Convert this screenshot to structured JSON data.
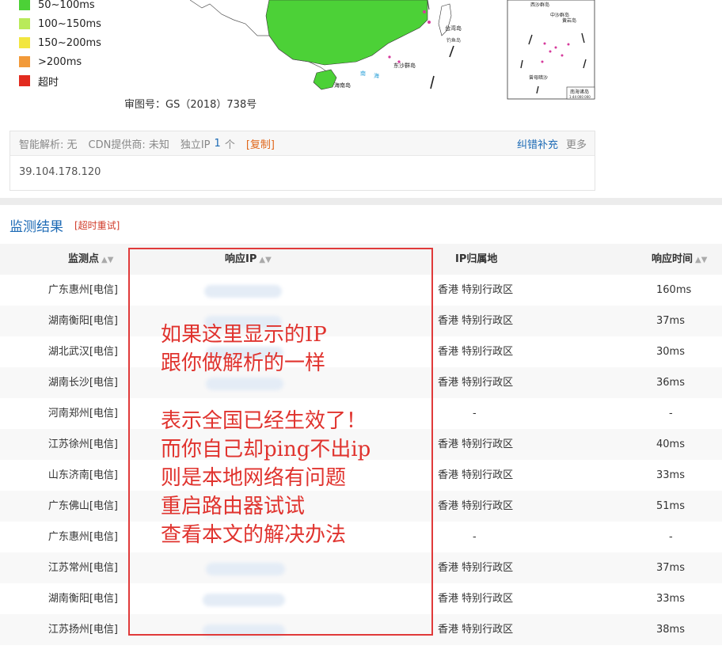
{
  "legend": [
    {
      "label": "50~100ms",
      "color": "#4cd137"
    },
    {
      "label": "100~150ms",
      "color": "#b9ea5a"
    },
    {
      "label": "150~200ms",
      "color": "#f2e640"
    },
    {
      "label": ">200ms",
      "color": "#f29a39"
    },
    {
      "label": "超时",
      "color": "#e22b1f"
    }
  ],
  "map_labels": {
    "taiwan": "台湾岛",
    "hainan": "海南岛",
    "dongsha": "东沙群岛",
    "nanhai": "南海诸岛",
    "xisha": "西沙群岛",
    "zhongsha": "中沙群岛",
    "huangyan": "黄岩岛",
    "zengmu": "曾母暗沙",
    "scale": "1:44 000 000",
    "diaoyu": "钓鱼岛",
    "nan": "南",
    "hai": "海"
  },
  "approval": "审图号：GS（2018）738号",
  "dns": {
    "smart_label": "智能解析: 无",
    "cdn_label": "CDN提供商: 未知",
    "ip_prefix": "独立IP",
    "ip_count": "1",
    "ip_unit": "个",
    "copy": "[复制]",
    "correct": "纠错补充",
    "more": "更多",
    "ip": "39.104.178.120"
  },
  "results": {
    "title": "监测结果",
    "retry": "[超时重试]",
    "headers": {
      "point": "监测点",
      "ip": "响应IP",
      "geo": "IP归属地",
      "time": "响应时间"
    },
    "sort_icon": "▲▼",
    "rows": [
      {
        "point": "广东惠州[电信]",
        "geo": "香港 特别行政区",
        "time": "160ms"
      },
      {
        "point": "湖南衡阳[电信]",
        "geo": "香港 特别行政区",
        "time": "37ms"
      },
      {
        "point": "湖北武汉[电信]",
        "geo": "香港 特别行政区",
        "time": "30ms"
      },
      {
        "point": "湖南长沙[电信]",
        "geo": "香港 特别行政区",
        "time": "36ms"
      },
      {
        "point": "河南郑州[电信]",
        "geo": "-",
        "time": "-"
      },
      {
        "point": "江苏徐州[电信]",
        "geo": "香港 特别行政区",
        "time": "40ms"
      },
      {
        "point": "山东济南[电信]",
        "geo": "香港 特别行政区",
        "time": "33ms"
      },
      {
        "point": "广东佛山[电信]",
        "geo": "香港 特别行政区",
        "time": "51ms"
      },
      {
        "point": "广东惠州[电信]",
        "geo": "-",
        "time": "-"
      },
      {
        "point": "江苏常州[电信]",
        "geo": "香港 特别行政区",
        "time": "37ms"
      },
      {
        "point": "湖南衡阳[电信]",
        "geo": "香港 特别行政区",
        "time": "33ms"
      },
      {
        "point": "江苏扬州[电信]",
        "geo": "香港 特别行政区",
        "time": "38ms"
      }
    ]
  },
  "annotation": "如果这里显示的IP\n跟你做解析的一样\n\n表示全国已经生效了！\n而你自己却ping不出ip\n则是本地网络有问题\n重启路由器试试\n查看本文的解决办法"
}
